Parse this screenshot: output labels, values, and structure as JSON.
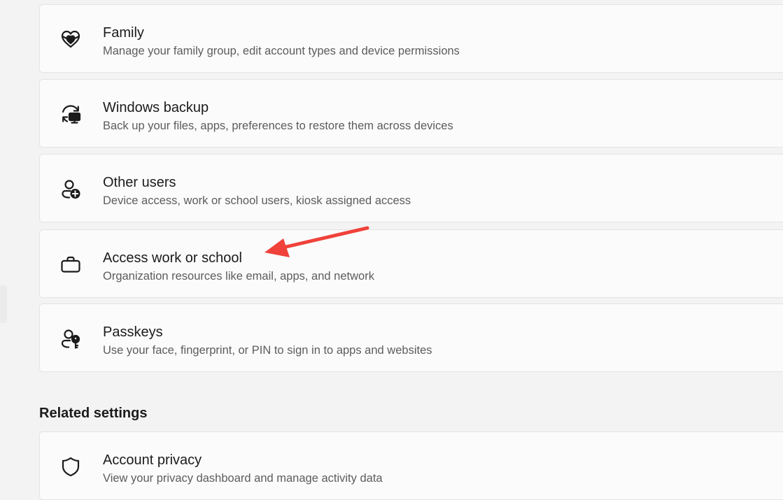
{
  "items": [
    {
      "title": "Family",
      "description": "Manage your family group, edit account types and device permissions",
      "icon": "family-heart-icon"
    },
    {
      "title": "Windows backup",
      "description": "Back up your files, apps, preferences to restore them across devices",
      "icon": "backup-sync-icon"
    },
    {
      "title": "Other users",
      "description": "Device access, work or school users, kiosk assigned access",
      "icon": "person-add-icon"
    },
    {
      "title": "Access work or school",
      "description": "Organization resources like email, apps, and network",
      "icon": "briefcase-icon"
    },
    {
      "title": "Passkeys",
      "description": "Use your face, fingerprint, or PIN to sign in to apps and websites",
      "icon": "person-key-icon"
    }
  ],
  "related": {
    "heading": "Related settings",
    "items": [
      {
        "title": "Account privacy",
        "description": "View your privacy dashboard and manage activity data",
        "icon": "shield-icon"
      }
    ]
  },
  "annotation": {
    "color": "#f0423a",
    "icon": "red-arrow-icon"
  }
}
